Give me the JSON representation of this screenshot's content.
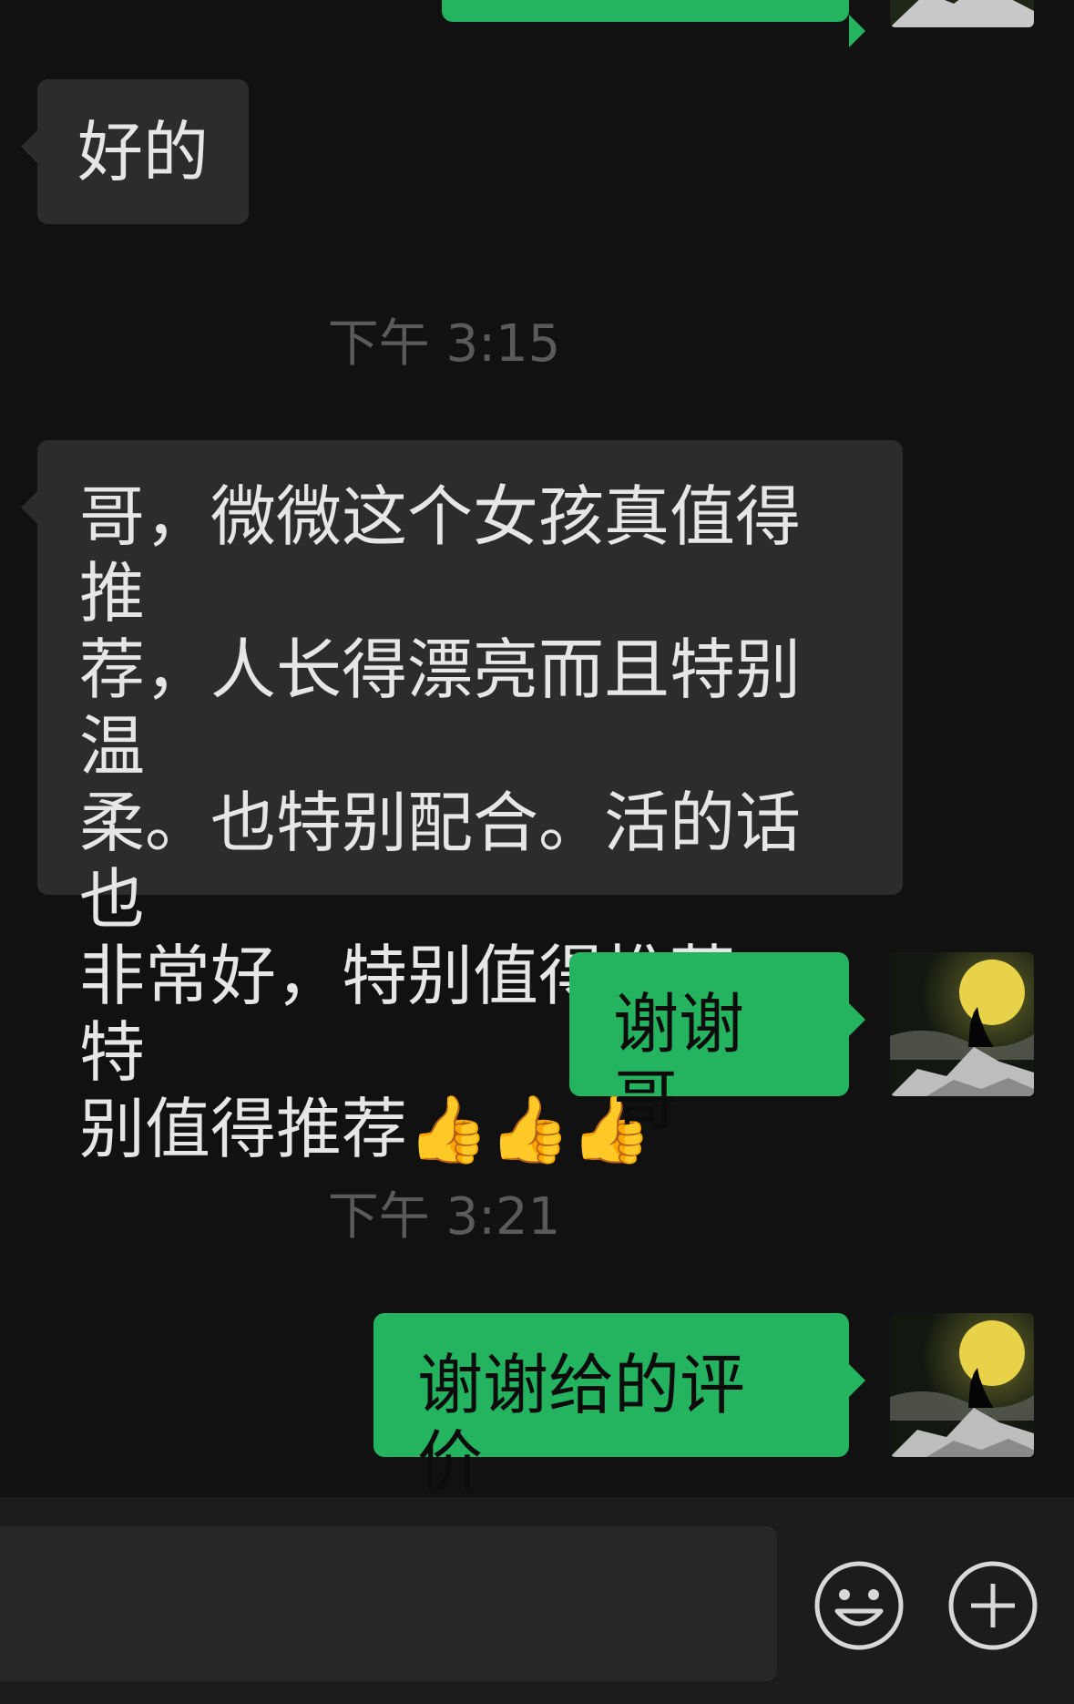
{
  "messages": [
    {
      "side": "out",
      "text": ""
    },
    {
      "side": "in",
      "text": "好的"
    },
    {
      "type": "time",
      "text": "下午 3:15"
    },
    {
      "side": "in",
      "lines": [
        "哥，微微这个女孩真值得推",
        "荐，人长得漂亮而且特别温",
        "柔。也特别配合。活的话也",
        "非常好，特别值得推荐，特",
        "别值得推荐👍👍👍"
      ]
    },
    {
      "side": "out",
      "text": "谢谢哥"
    },
    {
      "type": "time",
      "text": "下午 3:21"
    },
    {
      "side": "out",
      "text": "谢谢给的评价"
    }
  ],
  "colors": {
    "background": "#111111",
    "incoming_bubble": "#2c2c2c",
    "outgoing_bubble": "#24b35f",
    "timestamp": "#5a5a5a"
  },
  "icons": {
    "emoji_button": "smiley-face-icon",
    "more_button": "plus-circle-icon",
    "avatar": "wolf-moon-avatar"
  }
}
